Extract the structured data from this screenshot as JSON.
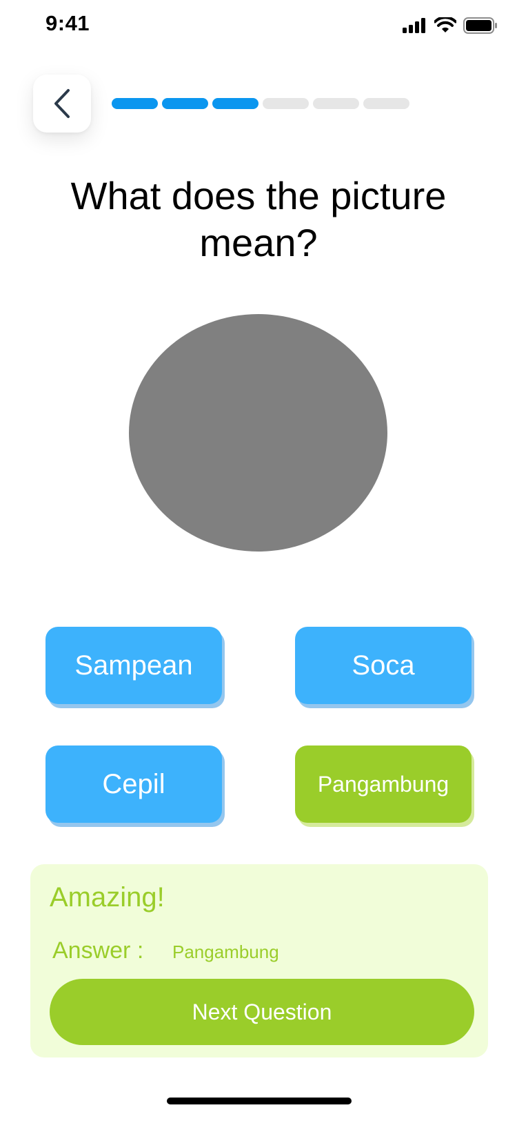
{
  "status_bar": {
    "time": "9:41",
    "icons": [
      "cellular-signal-icon",
      "wifi-icon",
      "battery-icon"
    ]
  },
  "nav": {
    "back_icon": "chevron-left-icon"
  },
  "progress": {
    "completed_steps": 3,
    "total_steps": 6,
    "active_color": "#0b96ef",
    "inactive_color": "#e6e6e6"
  },
  "question": {
    "title": "What does the picture mean?"
  },
  "options": [
    {
      "label": "Sampean",
      "state": "default"
    },
    {
      "label": "Soca",
      "state": "default"
    },
    {
      "label": "Cepil",
      "state": "default"
    },
    {
      "label": "Pangambung",
      "state": "correct"
    }
  ],
  "feedback": {
    "heading": "Amazing!",
    "answer_label": "Answer :",
    "answer_value": "Pangambung",
    "next_button_label": "Next Question"
  },
  "colors": {
    "option_default": "#3db2fc",
    "option_correct": "#9acd2a",
    "feedback_background": "#f1fdd9",
    "image_placeholder": "#808080"
  }
}
